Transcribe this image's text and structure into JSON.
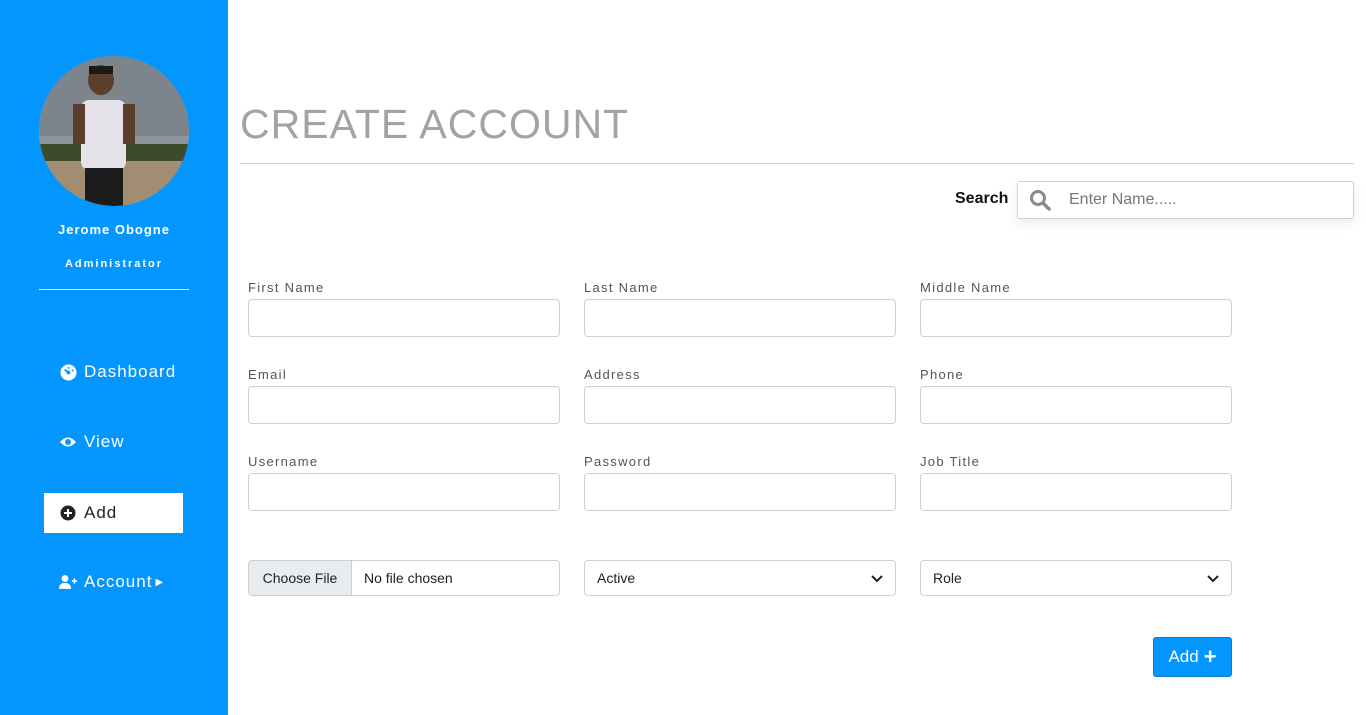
{
  "sidebar": {
    "user_name": "Jerome Obogne",
    "user_role": "Administrator",
    "nav": [
      {
        "label": "Dashboard",
        "icon": "dashboard-icon"
      },
      {
        "label": "View",
        "icon": "eye-icon"
      },
      {
        "label": "Add",
        "icon": "plus-circle-icon",
        "active": true
      },
      {
        "label": "Account",
        "icon": "user-plus-icon"
      }
    ]
  },
  "main": {
    "title": "CREATE ACCOUNT",
    "search": {
      "label": "Search",
      "placeholder": "Enter Name....."
    },
    "fields": {
      "first_name": "First Name",
      "last_name": "Last Name",
      "middle_name": "Middle Name",
      "email": "Email",
      "address": "Address",
      "phone": "Phone",
      "username": "Username",
      "password": "Password",
      "job_title": "Job Title"
    },
    "file_input": {
      "button": "Choose File",
      "status": "No file chosen"
    },
    "status_select": "Active",
    "role_select": "Role",
    "add_button": "Add"
  },
  "colors": {
    "sidebar": "#0396ff",
    "title": "#a3a3a3",
    "button": "#0396ff"
  }
}
